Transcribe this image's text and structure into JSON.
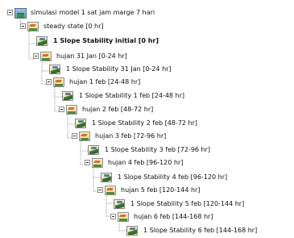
{
  "tree": {
    "root": {
      "label": "simulasi model 1 sat jam marge 7 hari",
      "icon": "project-globe-icon",
      "expanded": true
    },
    "nodes": [
      {
        "label": "steady state [0 hr]",
        "icon": "stage-folder-icon",
        "expanded": true,
        "bold": false
      },
      {
        "label": "1 Slope Stability initial [0 hr]",
        "icon": "slope-analysis-icon",
        "bold": true
      },
      {
        "label": "hujan 31 Jan [0-24 hr]",
        "icon": "stage-folder-icon",
        "expanded": true,
        "bold": false
      },
      {
        "label": "1 Slope Stability 31 Jan [0-24 hr]",
        "icon": "slope-analysis-icon",
        "bold": false
      },
      {
        "label": "hujan 1 feb [24-48 hr]",
        "icon": "stage-folder-icon",
        "expanded": true,
        "bold": false
      },
      {
        "label": "1 Slope Stability 1 feb [24-48 hr]",
        "icon": "slope-analysis-icon",
        "bold": false
      },
      {
        "label": "hujan 2 feb [48-72 hr]",
        "icon": "stage-folder-icon",
        "expanded": true,
        "bold": false
      },
      {
        "label": "1 Slope Stability 2 feb [48-72 hr]",
        "icon": "slope-analysis-icon",
        "bold": false
      },
      {
        "label": "hujan 3 feb [72-96 hr]",
        "icon": "stage-folder-icon",
        "expanded": true,
        "bold": false
      },
      {
        "label": "1 Slope Stability 3 feb [72-96 hr]",
        "icon": "slope-analysis-icon",
        "bold": false
      },
      {
        "label": "hujan 4 feb [96-120 hr]",
        "icon": "stage-folder-icon",
        "expanded": true,
        "bold": false
      },
      {
        "label": "1 Slope Stability 4 feb [96-120 hr]",
        "icon": "slope-analysis-icon",
        "bold": false
      },
      {
        "label": "hujan 5 feb [120-144 hr]",
        "icon": "stage-folder-icon",
        "expanded": true,
        "bold": false
      },
      {
        "label": "1 Slope Stability 5 feb [120-144 hr]",
        "icon": "slope-analysis-icon",
        "bold": false
      },
      {
        "label": "hujan 6 feb [144-168 hr]",
        "icon": "stage-folder-icon",
        "expanded": true,
        "bold": false
      },
      {
        "label": "1 Slope Stability 6 feb [144-168 hr]",
        "icon": "slope-analysis-icon",
        "bold": false
      }
    ]
  }
}
